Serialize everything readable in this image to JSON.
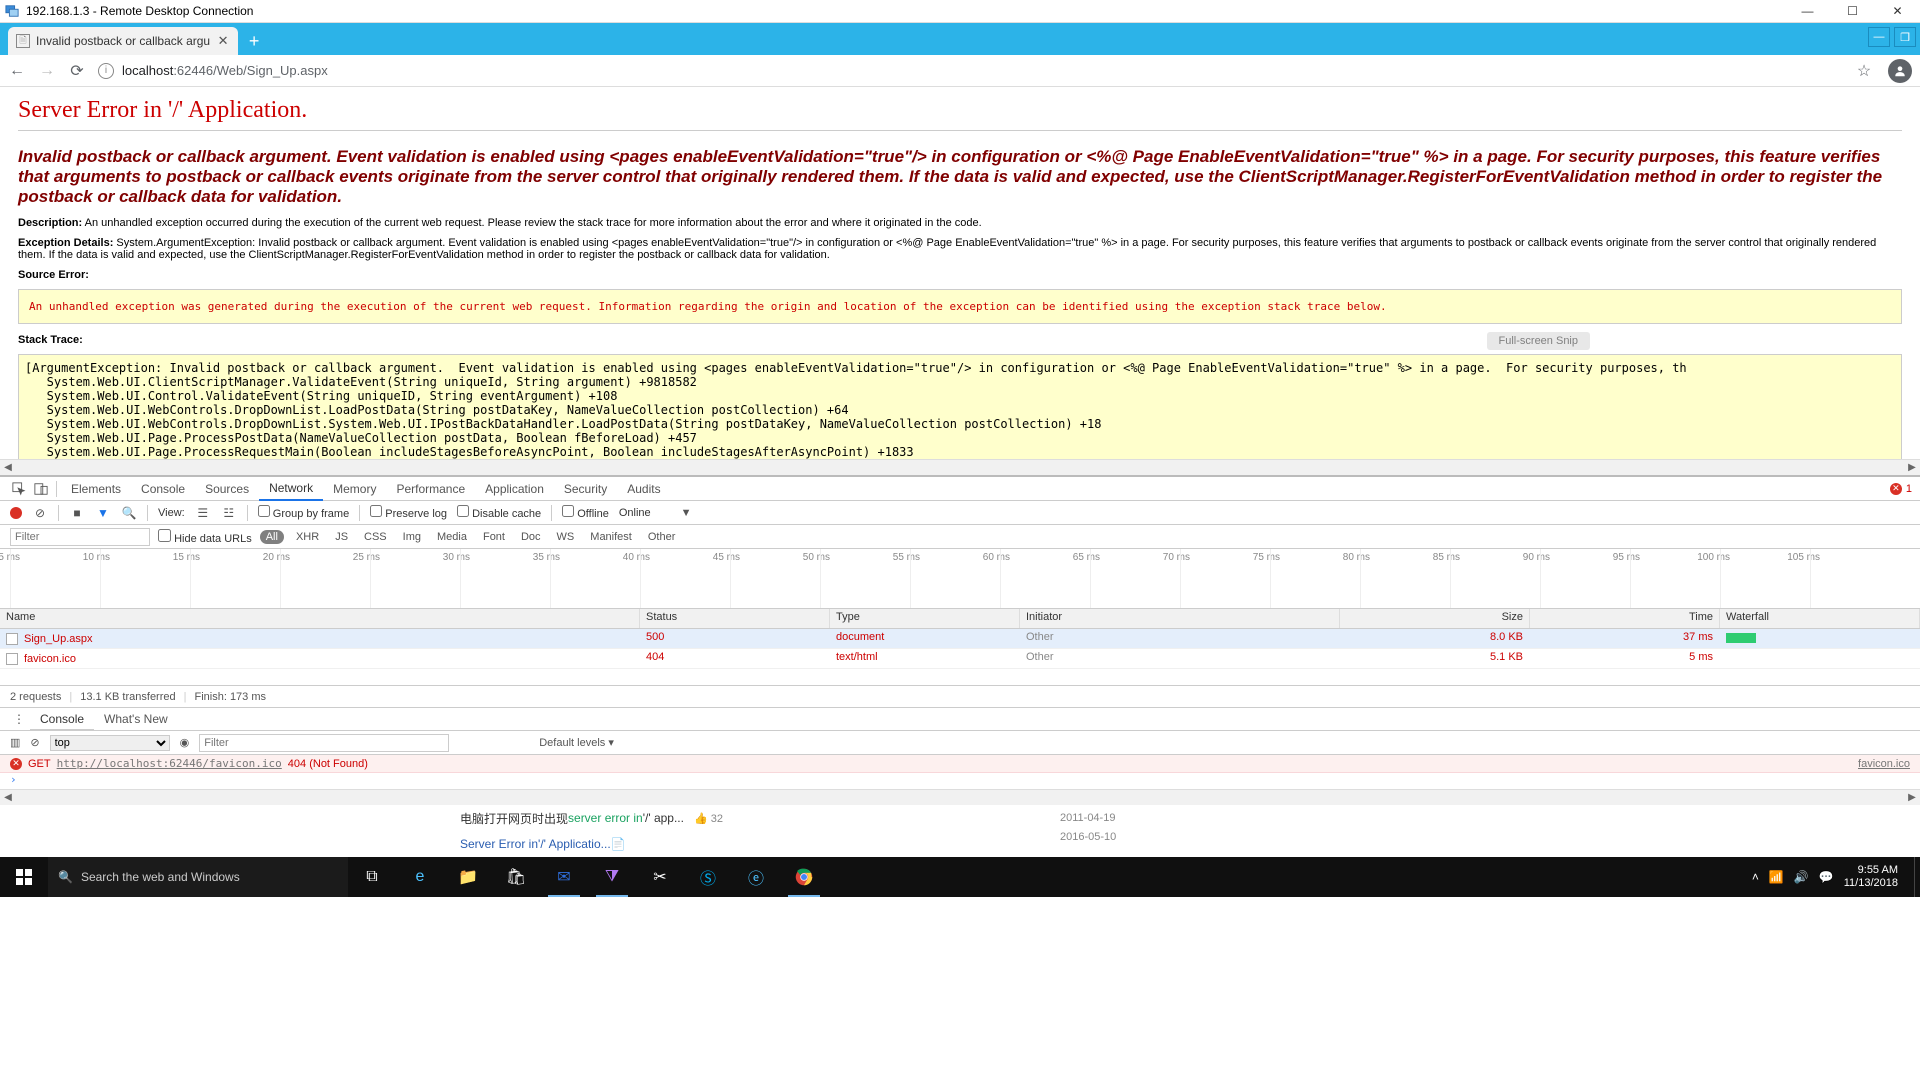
{
  "rdc": {
    "title": "192.168.1.3 - Remote Desktop Connection"
  },
  "chrome": {
    "tab_title": "Invalid postback or callback argu",
    "url_host": "localhost",
    "url_port": ":62446",
    "url_path": "/Web/Sign_Up.aspx"
  },
  "error_page": {
    "h1": "Server Error in '/' Application.",
    "headline": "Invalid postback or callback argument.  Event validation is enabled using <pages enableEventValidation=\"true\"/> in configuration or <%@ Page EnableEventValidation=\"true\" %> in a page.  For security purposes, this feature verifies that arguments to postback or callback events originate from the server control that originally rendered them.  If the data is valid and expected, use the ClientScriptManager.RegisterForEventValidation method in order to register the postback or callback data for validation.",
    "description_label": "Description:",
    "description_text": "An unhandled exception occurred during the execution of the current web request. Please review the stack trace for more information about the error and where it originated in the code.",
    "exception_label": "Exception Details:",
    "exception_text": "System.ArgumentException: Invalid postback or callback argument.  Event validation is enabled using <pages enableEventValidation=\"true\"/> in configuration or <%@ Page EnableEventValidation=\"true\" %> in a page.  For security purposes, this feature verifies that arguments to postback or callback events originate from the server control that originally rendered them.  If the data is valid and expected, use the ClientScriptManager.RegisterForEventValidation method in order to register the postback or callback data for validation.",
    "source_label": "Source Error:",
    "source_text": "An unhandled exception was generated during the execution of the current web request. Information regarding the origin and location of the exception can be identified using the exception stack trace below.",
    "stack_label": "Stack Trace:",
    "stack_text": "[ArgumentException: Invalid postback or callback argument.  Event validation is enabled using <pages enableEventValidation=\"true\"/> in configuration or <%@ Page EnableEventValidation=\"true\" %> in a page.  For security purposes, th\n   System.Web.UI.ClientScriptManager.ValidateEvent(String uniqueId, String argument) +9818582\n   System.Web.UI.Control.ValidateEvent(String uniqueID, String eventArgument) +108\n   System.Web.UI.WebControls.DropDownList.LoadPostData(String postDataKey, NameValueCollection postCollection) +64\n   System.Web.UI.WebControls.DropDownList.System.Web.UI.IPostBackDataHandler.LoadPostData(String postDataKey, NameValueCollection postCollection) +18\n   System.Web.UI.Page.ProcessPostData(NameValueCollection postData, Boolean fBeforeLoad) +457\n   System.Web.UI.Page.ProcessRequestMain(Boolean includeStagesBeforeAsyncPoint, Boolean includeStagesAfterAsyncPoint) +1833",
    "snip_btn": "Full-screen Snip"
  },
  "devtools": {
    "tabs": [
      "Elements",
      "Console",
      "Sources",
      "Network",
      "Memory",
      "Performance",
      "Application",
      "Security",
      "Audits"
    ],
    "active_tab": "Network",
    "error_count": "1",
    "nettool": {
      "view_label": "View:",
      "group": "Group by frame",
      "preserve": "Preserve log",
      "disable_cache": "Disable cache",
      "offline": "Offline",
      "online": "Online"
    },
    "filterbar": {
      "filter_ph": "Filter",
      "hide": "Hide data URLs",
      "types": [
        "All",
        "XHR",
        "JS",
        "CSS",
        "Img",
        "Media",
        "Font",
        "Doc",
        "WS",
        "Manifest",
        "Other"
      ]
    },
    "timeline_ticks": [
      "5 ms",
      "10 ms",
      "15 ms",
      "20 ms",
      "25 ms",
      "30 ms",
      "35 ms",
      "40 ms",
      "45 ms",
      "50 ms",
      "55 ms",
      "60 ms",
      "65 ms",
      "70 ms",
      "75 ms",
      "80 ms",
      "85 ms",
      "90 ms",
      "95 ms",
      "100 ms",
      "105 ms"
    ],
    "columns": {
      "name": "Name",
      "status": "Status",
      "type": "Type",
      "initiator": "Initiator",
      "size": "Size",
      "time": "Time",
      "waterfall": "Waterfall"
    },
    "rows": [
      {
        "name": "Sign_Up.aspx",
        "status": "500",
        "type": "document",
        "initiator": "Other",
        "size": "8.0 KB",
        "time": "37 ms",
        "barw": "30px"
      },
      {
        "name": "favicon.ico",
        "status": "404",
        "type": "text/html",
        "initiator": "Other",
        "size": "5.1 KB",
        "time": "5 ms",
        "barw": "0px"
      }
    ],
    "summary": {
      "requests": "2 requests",
      "transferred": "13.1 KB transferred",
      "finish": "Finish: 173 ms"
    },
    "drawer_tabs": [
      "Console",
      "What's New"
    ],
    "console_tool": {
      "context": "top",
      "filter_ph": "Filter",
      "levels": "Default levels ▾"
    },
    "console_err": {
      "method": "GET",
      "url": "http://localhost:62446/favicon.ico",
      "status": "404 (Not Found)",
      "source": "favicon.ico"
    }
  },
  "bottom_strip": {
    "rows": [
      {
        "pre": "电脑打开网页时出现",
        "link": "server error in",
        "post": "'/' app...",
        "extra": "👍 32",
        "date": "2011-04-19"
      },
      {
        "pre": "",
        "link": "Server Error in",
        "post": " '/' Applicatio...📄",
        "extra": "",
        "date": "2016-05-10"
      }
    ]
  },
  "taskbar": {
    "search_ph": "Search the web and Windows",
    "time": "9:55 AM",
    "date": "11/13/2018"
  }
}
